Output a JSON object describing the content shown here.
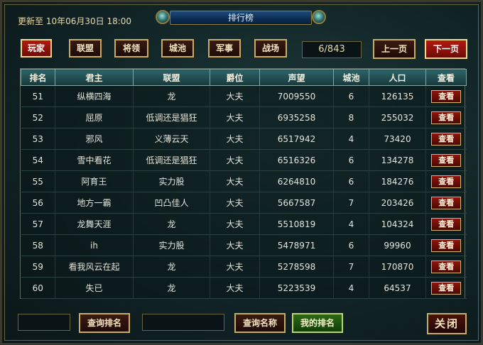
{
  "header": {
    "update_text": "更新至 10年06月30日 18:00",
    "title": "排行榜"
  },
  "tabs": [
    {
      "label": "玩家",
      "active": true
    },
    {
      "label": "联盟",
      "active": false
    },
    {
      "label": "将领",
      "active": false
    },
    {
      "label": "城池",
      "active": false
    },
    {
      "label": "军事",
      "active": false
    },
    {
      "label": "战场",
      "active": false
    }
  ],
  "pager": {
    "counter": "6/843",
    "prev_label": "上一页",
    "next_label": "下一页"
  },
  "table": {
    "columns": [
      "排名",
      "君主",
      "联盟",
      "爵位",
      "声望",
      "城池",
      "人口",
      "查看"
    ],
    "view_label": "查看",
    "rows": [
      {
        "rank": "51",
        "lord": "纵横四海",
        "alliance": "龙",
        "title": "大夫",
        "prestige": "7009550",
        "cities": "6",
        "population": "126135"
      },
      {
        "rank": "52",
        "lord": "屈原",
        "alliance": "低调还是猖狂",
        "title": "大夫",
        "prestige": "6935258",
        "cities": "8",
        "population": "255032"
      },
      {
        "rank": "53",
        "lord": "邪风",
        "alliance": "义薄云天",
        "title": "大夫",
        "prestige": "6517942",
        "cities": "4",
        "population": "73420"
      },
      {
        "rank": "54",
        "lord": "雪中看花",
        "alliance": "低调还是猖狂",
        "title": "大夫",
        "prestige": "6516326",
        "cities": "6",
        "population": "134278"
      },
      {
        "rank": "55",
        "lord": "阿育王",
        "alliance": "实力股",
        "title": "大夫",
        "prestige": "6264810",
        "cities": "6",
        "population": "184276"
      },
      {
        "rank": "56",
        "lord": "地方一霸",
        "alliance": "凹凸佳人",
        "title": "大夫",
        "prestige": "5667587",
        "cities": "7",
        "population": "203426"
      },
      {
        "rank": "57",
        "lord": "龙舞天涯",
        "alliance": "龙",
        "title": "大夫",
        "prestige": "5510819",
        "cities": "4",
        "population": "104324"
      },
      {
        "rank": "58",
        "lord": "ih",
        "alliance": "实力股",
        "title": "大夫",
        "prestige": "5478971",
        "cities": "6",
        "population": "99960"
      },
      {
        "rank": "59",
        "lord": "看我风云在起",
        "alliance": "龙",
        "title": "大夫",
        "prestige": "5278598",
        "cities": "7",
        "population": "170870"
      },
      {
        "rank": "60",
        "lord": "失已",
        "alliance": "龙",
        "title": "大夫",
        "prestige": "5223539",
        "cities": "4",
        "population": "64537"
      }
    ]
  },
  "footer": {
    "rank_query_input": "",
    "rank_query_label": "查询排名",
    "name_query_input": "",
    "name_query_label": "查询名称",
    "my_rank_label": "我的排名",
    "close_label": "关闭"
  }
}
